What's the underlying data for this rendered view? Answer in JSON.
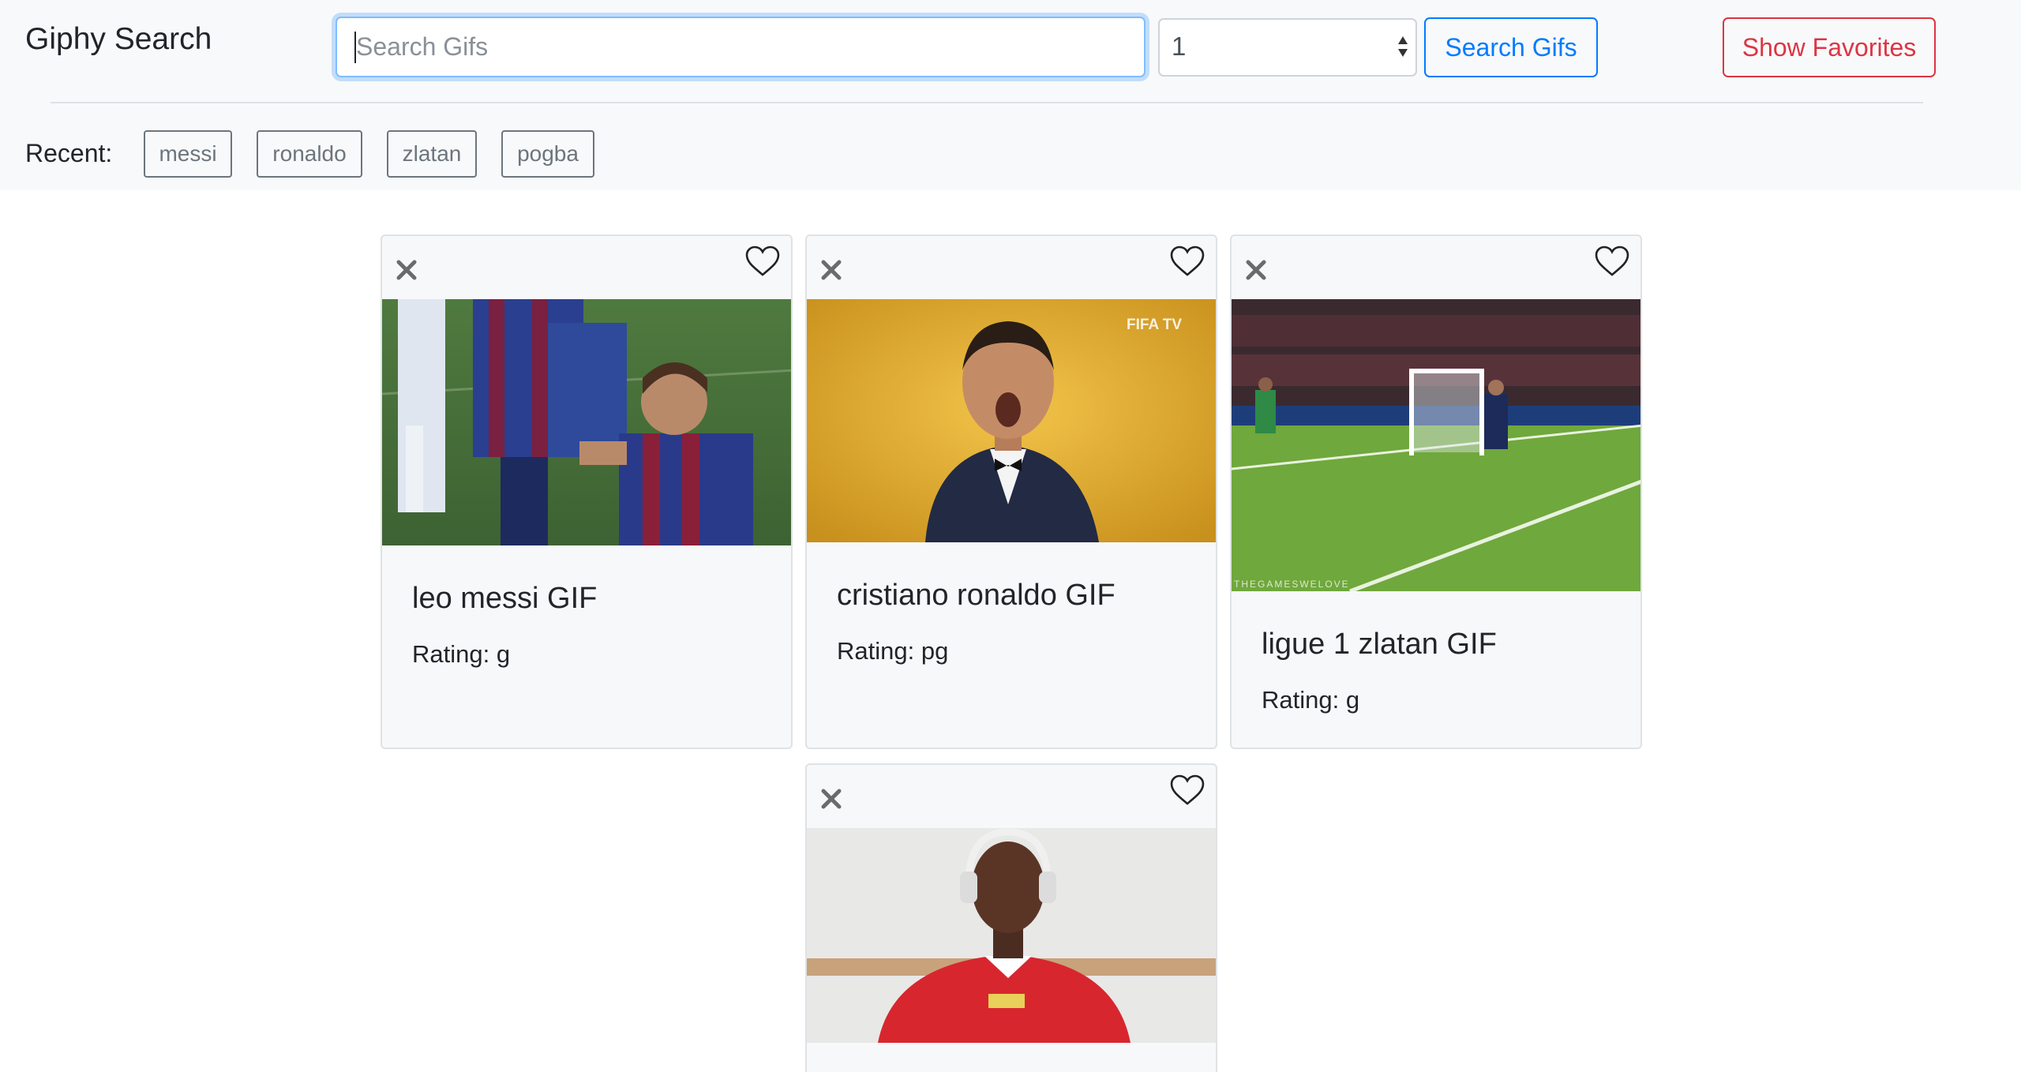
{
  "app": {
    "title": "Giphy Search"
  },
  "search": {
    "placeholder": "Search Gifs",
    "value": ""
  },
  "limit": {
    "value": "1"
  },
  "buttons": {
    "search_label": "Search Gifs",
    "favorites_label": "Show Favorites"
  },
  "recent": {
    "label": "Recent:",
    "items": [
      "messi",
      "ronaldo",
      "zlatan",
      "pogba"
    ]
  },
  "colors": {
    "primary": "#007bff",
    "danger": "#dc3545",
    "secondary": "#6c757d",
    "header_bg": "#f8f9fa"
  },
  "results": [
    {
      "title": "leo messi GIF",
      "rating": "Rating: g",
      "icons": [
        "close-icon",
        "heart-outline-icon"
      ]
    },
    {
      "title": "cristiano ronaldo GIF",
      "rating": "Rating: pg",
      "watermark": "FIFA TV",
      "icons": [
        "close-icon",
        "heart-outline-icon"
      ]
    },
    {
      "title": "ligue 1 zlatan GIF",
      "rating": "Rating: g",
      "watermark": "THEGAMESWELOVE",
      "icons": [
        "close-icon",
        "heart-outline-icon"
      ]
    },
    {
      "title": "",
      "rating": "",
      "icons": [
        "close-icon",
        "heart-outline-icon"
      ]
    }
  ]
}
